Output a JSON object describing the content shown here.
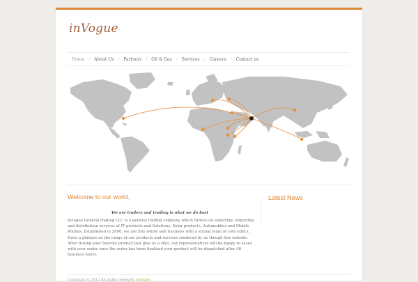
{
  "site": {
    "logo": "inVogue"
  },
  "nav": {
    "items": [
      {
        "label": "Home",
        "active": true
      },
      {
        "label": "About Us"
      },
      {
        "label": "Partners"
      },
      {
        "label": "Oil & Gas"
      },
      {
        "label": "Services"
      },
      {
        "label": "Careers"
      },
      {
        "label": "Contact us"
      }
    ],
    "separator": "/"
  },
  "welcome": {
    "title": "Welcome to our world,",
    "tagline": "We are traders and trading is what we do best",
    "body": "Invogue General trading LLC is a general trading company which thrives on exporting, importing and distribution services of IT products and Solutions, Solar products, Automobiles and Mobile Phones. Established in 2006, we are into whole sale business with a strong team of core ethics. Have a glimpse on the range of our products and services rendered by us though this website. After ticking your favorite product just give us a shot, our representatives will be happy to assist with your order, once the order has been finalized your product will be dispatched after 48 business hours."
  },
  "news": {
    "title": "Latest News"
  },
  "footer": {
    "text": "Copyright © 2012 All rights reserved.",
    "credit": "Invogue"
  },
  "colors": {
    "accent": "#e2852a",
    "map_land": "#c2c2c2",
    "route": "#e8913a"
  }
}
